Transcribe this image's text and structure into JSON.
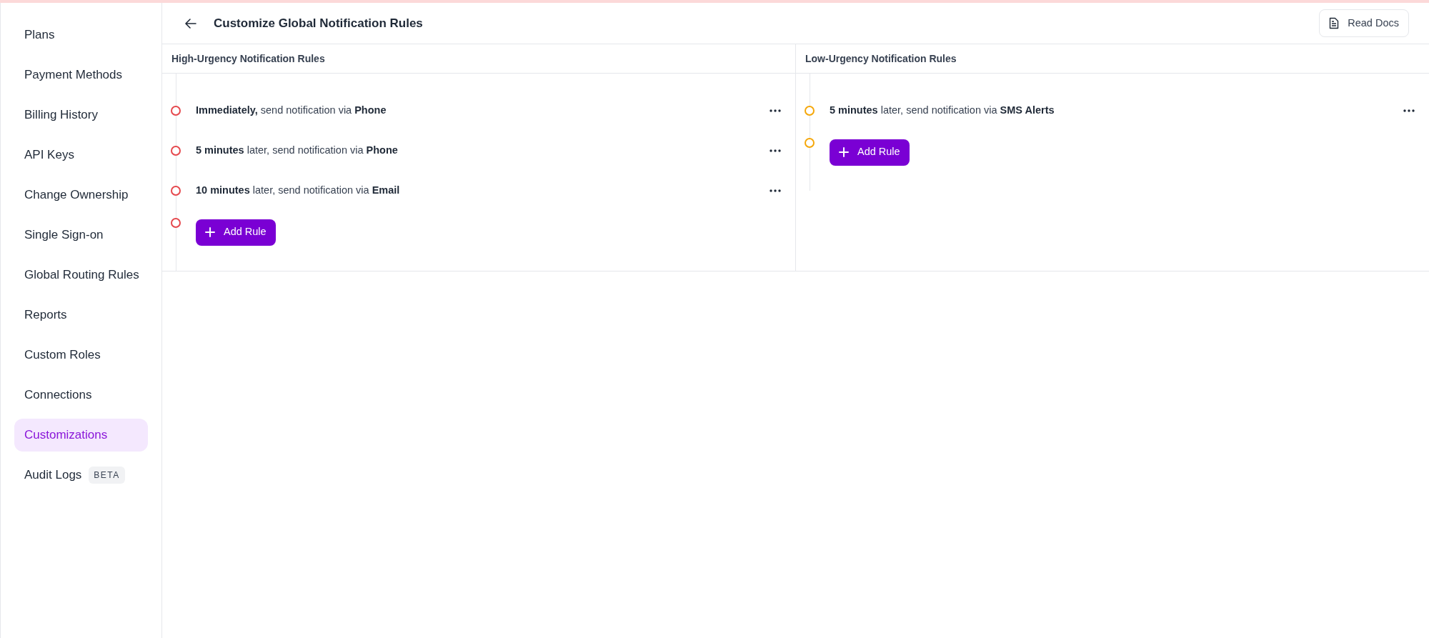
{
  "sidebar": {
    "items": [
      {
        "label": "Plans",
        "selected": false
      },
      {
        "label": "Payment Methods",
        "selected": false
      },
      {
        "label": "Billing History",
        "selected": false
      },
      {
        "label": "API Keys",
        "selected": false
      },
      {
        "label": "Change Ownership",
        "selected": false
      },
      {
        "label": "Single Sign-on",
        "selected": false
      },
      {
        "label": "Global Routing Rules",
        "selected": false
      },
      {
        "label": "Reports",
        "selected": false
      },
      {
        "label": "Custom Roles",
        "selected": false
      },
      {
        "label": "Connections",
        "selected": false
      },
      {
        "label": "Customizations",
        "selected": true
      },
      {
        "label": "Audit Logs",
        "selected": false,
        "badge": "BETA"
      }
    ]
  },
  "header": {
    "title": "Customize Global Notification Rules",
    "docs_button": "Read Docs"
  },
  "columns": [
    {
      "title": "High-Urgency Notification Rules",
      "color": "#e5484d",
      "rules": [
        "**Immediately,** send notification via **Phone**",
        "**5 minutes** later, send notification via **Phone**",
        "**10 minutes** later, send notification via **Email**"
      ],
      "add_button": "Add Rule"
    },
    {
      "title": "Low-Urgency Notification Rules",
      "color": "#f5a70a",
      "rules": [
        "**5 minutes** later, send notification via **SMS Alerts**"
      ],
      "add_button": "Add Rule"
    }
  ]
}
